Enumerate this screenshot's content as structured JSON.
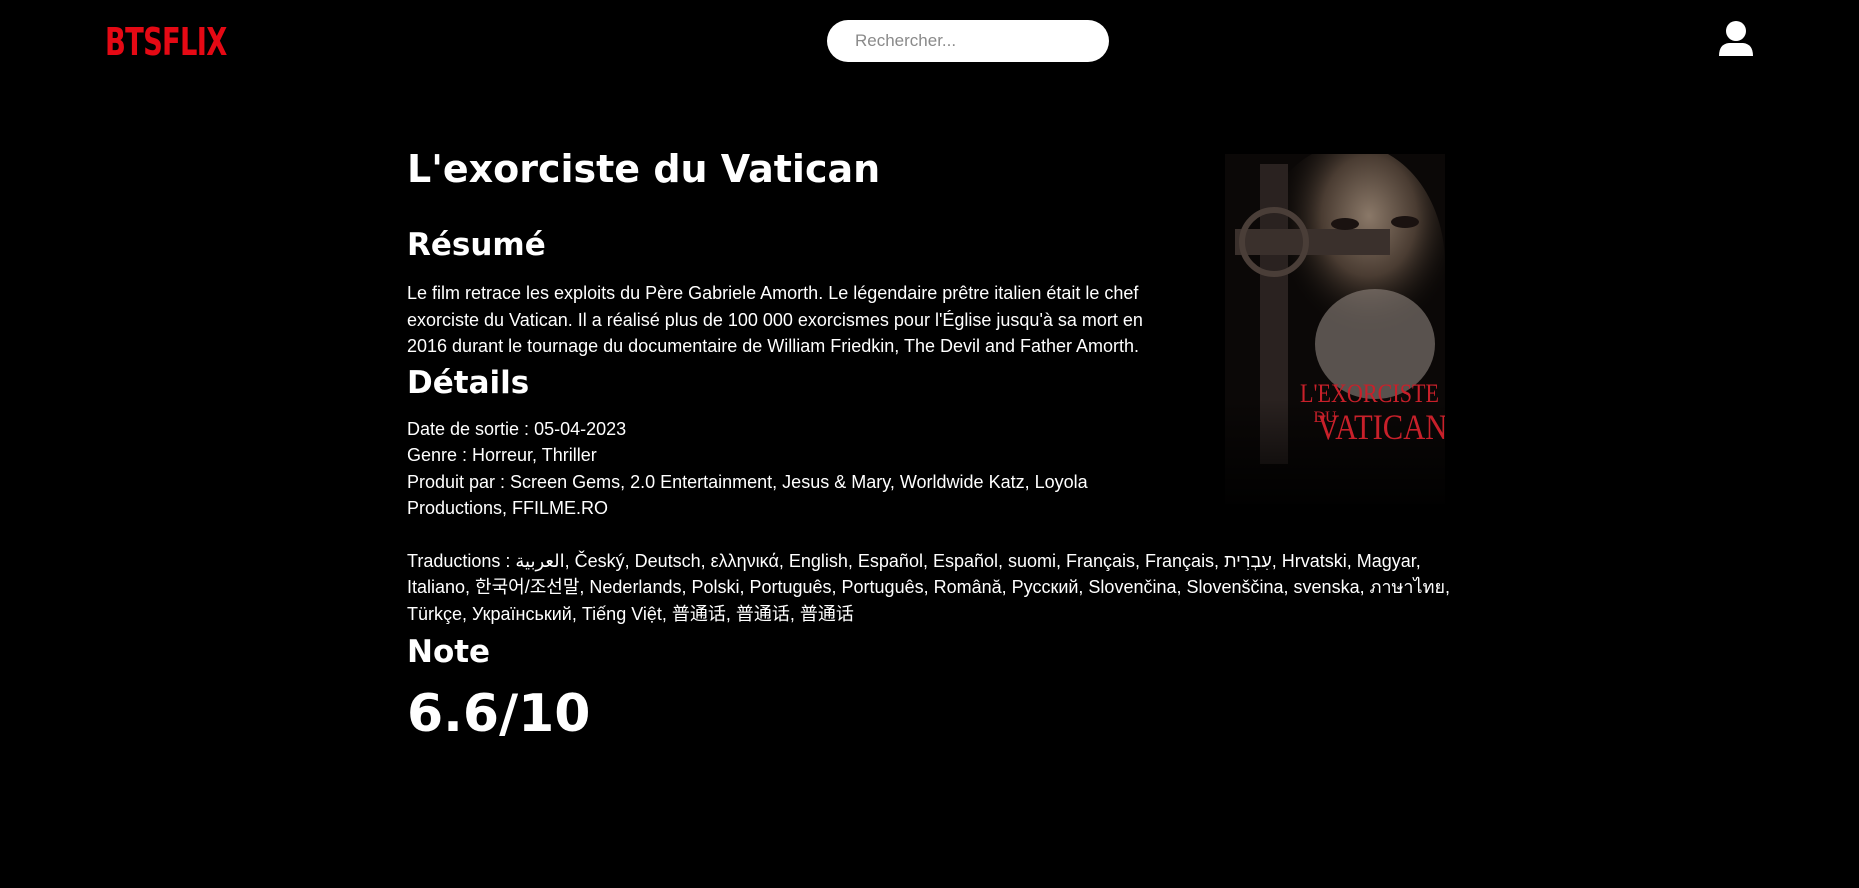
{
  "header": {
    "logo": "BTSFLIX",
    "search_placeholder": "Rechercher...",
    "user_icon": "user-icon"
  },
  "movie": {
    "title": "L'exorciste du Vatican",
    "summary_heading": "Résumé",
    "summary": "Le film retrace les exploits du Père Gabriele Amorth. Le légendaire prêtre italien était le chef exorciste du Vatican. Il a réalisé plus de 100 000 exorcismes pour l'Église jusqu'à sa mort en 2016 durant le tournage du documentaire de William Friedkin, The Devil and Father Amorth.",
    "details_heading": "Détails",
    "release_date": "Date de sortie : 05-04-2023",
    "genre": "Genre : Horreur, Thriller",
    "produced_by": "Produit par : Screen Gems, 2.0 Entertainment, Jesus & Mary, Worldwide Katz, Loyola Productions, FFILME.RO",
    "translations": "Traductions : العربية, Český, Deutsch, ελληνικά, English, Español, Español, suomi, Français, Français, עִבְרִית, Hrvatski, Magyar, Italiano, 한국어/조선말, Nederlands, Polski, Português, Português, Română, Русский, Slovenčina, Slovenščina, svenska, ภาษาไทย, Türkçe, Український, Tiếng Việt, 普通话, 普通话, 普通话",
    "rating_heading": "Note",
    "rating": "6.6/10",
    "poster": {
      "title_line1": "L'EXORCISTE",
      "title_line2": "DU",
      "title_line3": "VATICAN",
      "title_color": "#c8202a"
    }
  },
  "colors": {
    "background": "#000000",
    "brand": "#e50914",
    "text": "#ffffff"
  }
}
